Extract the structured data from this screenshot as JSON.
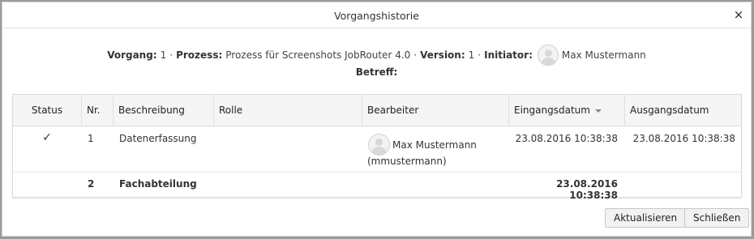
{
  "dialog": {
    "title": "Vorgangshistorie",
    "close_glyph": "×"
  },
  "info": {
    "vorgang_label": "Vorgang:",
    "vorgang_value": "1",
    "prozess_label": "Prozess:",
    "prozess_value": "Prozess für Screenshots JobRouter 4.0",
    "version_label": "Version:",
    "version_value": "1",
    "initiator_label": "Initiator:",
    "initiator_name": "Max Mustermann",
    "separator": "·",
    "betreff_label": "Betreff:"
  },
  "table": {
    "columns": [
      "Status",
      "Nr.",
      "Beschreibung",
      "Rolle",
      "Bearbeiter",
      "Eingangsdatum",
      "Ausgangsdatum"
    ],
    "sort_column": "Eingangsdatum",
    "rows": [
      {
        "status": "✓",
        "nr": "1",
        "beschreibung": "Datenerfassung",
        "rolle": "",
        "bearbeiter_name": "Max Mustermann",
        "bearbeiter_user": "(mmustermann)",
        "eingangsdatum": "23.08.2016 10:38:38",
        "ausgangsdatum": "23.08.2016 10:38:38"
      },
      {
        "status": "",
        "nr": "2",
        "beschreibung": "Fachabteilung",
        "rolle": "",
        "bearbeiter_name": "",
        "bearbeiter_user": "",
        "eingangsdatum": "23.08.2016 10:38:38",
        "ausgangsdatum": ""
      }
    ]
  },
  "buttons": {
    "refresh": "Aktualisieren",
    "close": "Schließen"
  }
}
